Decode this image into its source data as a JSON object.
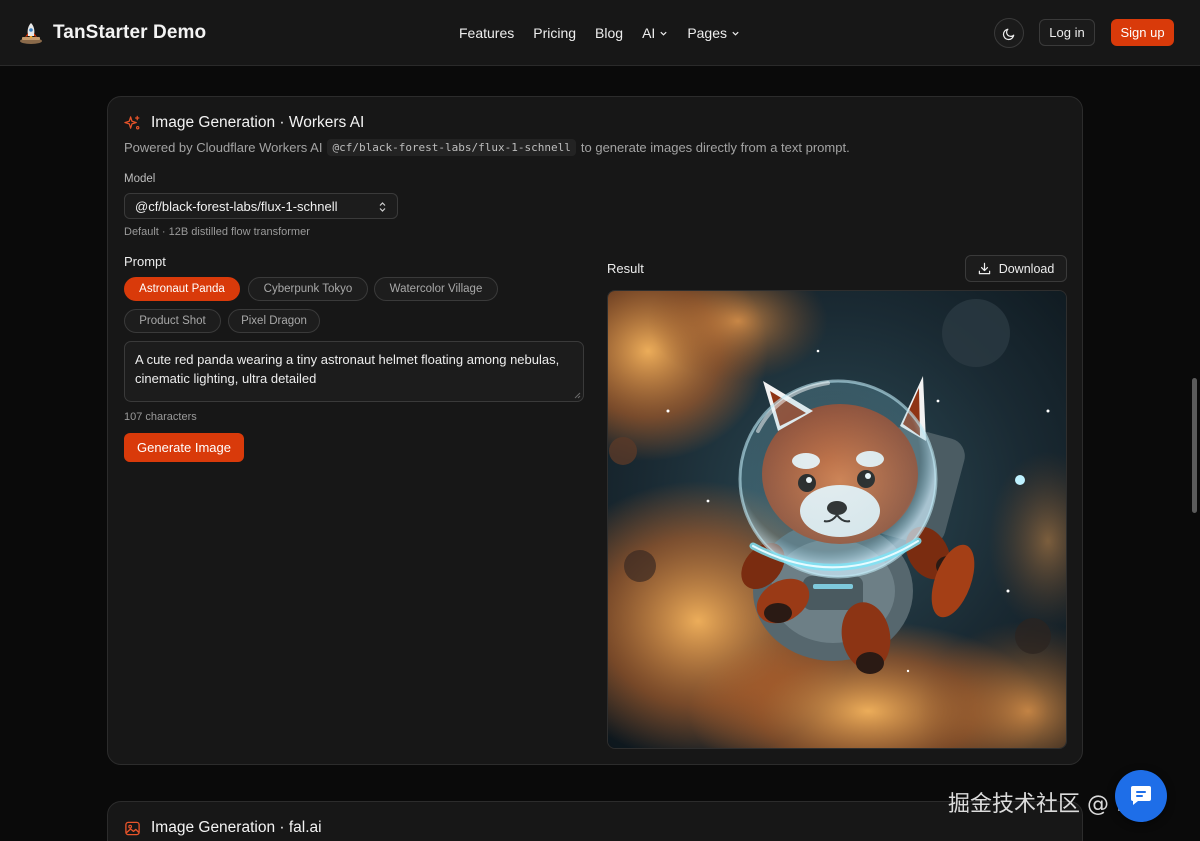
{
  "header": {
    "brand": "TanStarter Demo",
    "nav": [
      {
        "label": "Features"
      },
      {
        "label": "Pricing"
      },
      {
        "label": "Blog"
      },
      {
        "label": "AI"
      },
      {
        "label": "Pages"
      }
    ],
    "login_label": "Log in",
    "signup_label": "Sign up"
  },
  "card": {
    "title": "Image Generation · Workers AI",
    "desc_prefix": "Powered by Cloudflare Workers AI",
    "desc_code": "@cf/black-forest-labs/flux-1-schnell",
    "desc_suffix": "to generate images directly from a text prompt.",
    "model_label": "Model",
    "model_value": "@cf/black-forest-labs/flux-1-schnell",
    "model_hint": "Default · 12B distilled flow transformer",
    "prompt_label": "Prompt",
    "presets": [
      {
        "label": "Astronaut Panda",
        "active": true
      },
      {
        "label": "Cyberpunk Tokyo",
        "active": false
      },
      {
        "label": "Watercolor Village",
        "active": false
      },
      {
        "label": "Product Shot",
        "active": false
      },
      {
        "label": "Pixel Dragon",
        "active": false
      }
    ],
    "prompt_text": "A cute red panda wearing a tiny astronaut helmet floating among nebulas, cinematic lighting, ultra detailed",
    "char_count": "107 characters",
    "generate_label": "Generate Image",
    "result_label": "Result",
    "download_label": "Download"
  },
  "card2": {
    "title": "Image Generation · fal.ai"
  },
  "watermark": "掘金技术社区 @ Fox",
  "colors": {
    "accent": "#d93a0a",
    "background": "#0a0a0a",
    "card": "#171717"
  }
}
